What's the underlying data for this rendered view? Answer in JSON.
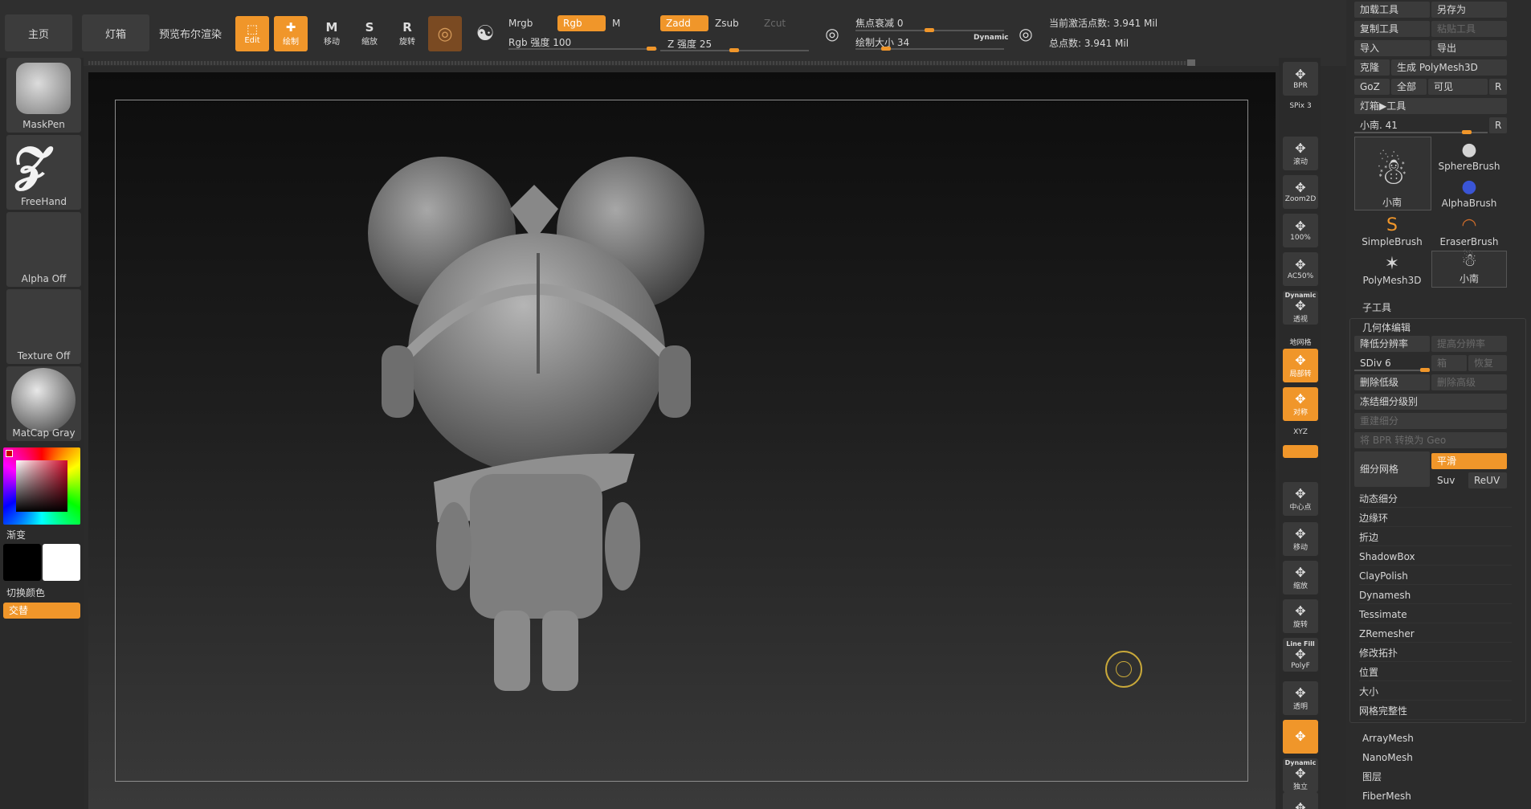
{
  "nav": {
    "home": "主页",
    "lightbox": "灯箱",
    "bpr_preview": "预览布尔渲染"
  },
  "tools": [
    {
      "icon": "edit-icon",
      "glyph": "⬚",
      "label": "Edit",
      "active": true
    },
    {
      "icon": "draw-icon",
      "glyph": "✚",
      "label": "绘制",
      "active": true
    },
    {
      "icon": "move-icon",
      "glyph": "M",
      "label": "移动",
      "active": false
    },
    {
      "icon": "scale-icon",
      "glyph": "S",
      "label": "缩放",
      "active": false
    },
    {
      "icon": "rotate-icon",
      "glyph": "R",
      "label": "旋转",
      "active": false
    }
  ],
  "color_modes": {
    "mrgb": "Mrgb",
    "rgb": "Rgb",
    "m": "M",
    "zadd": "Zadd",
    "zsub": "Zsub",
    "zcut": "Zcut"
  },
  "rgb_intensity": {
    "label": "Rgb 强度",
    "value": "100",
    "fraction": 1.0
  },
  "z_intensity": {
    "label": "Z 强度",
    "value": "25",
    "fraction": 0.25
  },
  "focal_shift": {
    "label": "焦点衰减",
    "value": "0",
    "fraction": 0.5
  },
  "draw_size": {
    "label": "绘制大小",
    "value": "34",
    "fraction": 0.2,
    "dynamic": "Dynamic"
  },
  "stats": {
    "active_points": "当前激活点数: 3.941 Mil",
    "total_points": "总点数: 3.941 Mil"
  },
  "left": {
    "brush": "MaskPen",
    "stroke": "FreeHand",
    "alpha": "Alpha Off",
    "texture": "Texture Off",
    "material": "MatCap Gray",
    "gradient": "渐变",
    "switch_color": "切换颜色",
    "alternate": "交替"
  },
  "strip": [
    {
      "icon": "bpr-icon",
      "label": "BPR"
    },
    {
      "icon": "spix-icon",
      "label": "SPix 3"
    },
    {
      "icon": "scroll-icon",
      "label": "滚动"
    },
    {
      "icon": "zoom2d-icon",
      "label": "Zoom2D"
    },
    {
      "icon": "zoom100-icon",
      "label": "100%"
    },
    {
      "icon": "zoom50-icon",
      "label": "AC50%"
    },
    {
      "icon": "perspective-icon",
      "label": "透视",
      "top": "Dynamic"
    },
    {
      "icon": "floor-icon",
      "label": "地网格"
    },
    {
      "icon": "local-icon",
      "label": "局部转",
      "active": true
    },
    {
      "icon": "symmetry-icon",
      "label": "对称",
      "active": true
    },
    {
      "icon": "xyz-icon",
      "label": "XYZ"
    },
    {
      "icon": "rotate-y-icon",
      "label": "",
      "active": true
    },
    {
      "icon": "rotate-z-icon",
      "label": ""
    },
    {
      "icon": "center-icon",
      "label": "中心点"
    },
    {
      "icon": "move-view-icon",
      "label": "移动"
    },
    {
      "icon": "scale-view-icon",
      "label": "缩放"
    },
    {
      "icon": "rotate-view-icon",
      "label": "旋转"
    },
    {
      "icon": "polyframe-icon",
      "label": "PolyF",
      "top": "Line Fill"
    },
    {
      "icon": "transparent-icon",
      "label": "透明"
    },
    {
      "icon": "ghost-icon",
      "label": "",
      "active": true
    },
    {
      "icon": "solo-icon",
      "label": "独立",
      "top": "Dynamic"
    },
    {
      "icon": "xpose-icon",
      "label": ""
    }
  ],
  "panel": {
    "load_tool": "加载工具",
    "save_as": "另存为",
    "copy_tool": "复制工具",
    "paste_tool": "粘贴工具",
    "import": "导入",
    "export": "导出",
    "clone": "克隆",
    "make_polymesh": "生成 PolyMesh3D",
    "goz": "GoZ",
    "all": "全部",
    "visible": "可见",
    "r": "R",
    "lightbox_tools": "灯箱▶工具",
    "current_tool": "小南. 41",
    "brushes": [
      "小南",
      "SphereBrush",
      "AlphaBrush",
      "SimpleBrush",
      "EraserBrush",
      "PolyMesh3D",
      "小南"
    ],
    "subtool": "子工具",
    "geometry": "几何体编辑",
    "lower_res": "降低分辨率",
    "higher_res": "提高分辨率",
    "sdiv": "SDiv 6",
    "cage": "箱",
    "reconstruct": "恢复",
    "del_lower": "删除低级",
    "del_higher": "删除高级",
    "freeze": "冻结细分级别",
    "reconstruct_subdiv": "重建细分",
    "convert_bpr": "将 BPR 转换为 Geo",
    "divide": "细分网格",
    "smooth": "平滑",
    "suv": "Suv",
    "reuv": "ReUV",
    "items": [
      "动态细分",
      "边缘环",
      "折边",
      "ShadowBox",
      "ClayPolish",
      "Dynamesh",
      "Tessimate",
      "ZRemesher",
      "修改拓扑",
      "位置",
      "大小",
      "网格完整性"
    ],
    "bottom": [
      "ArrayMesh",
      "NanoMesh",
      "图层",
      "FiberMesh"
    ]
  }
}
